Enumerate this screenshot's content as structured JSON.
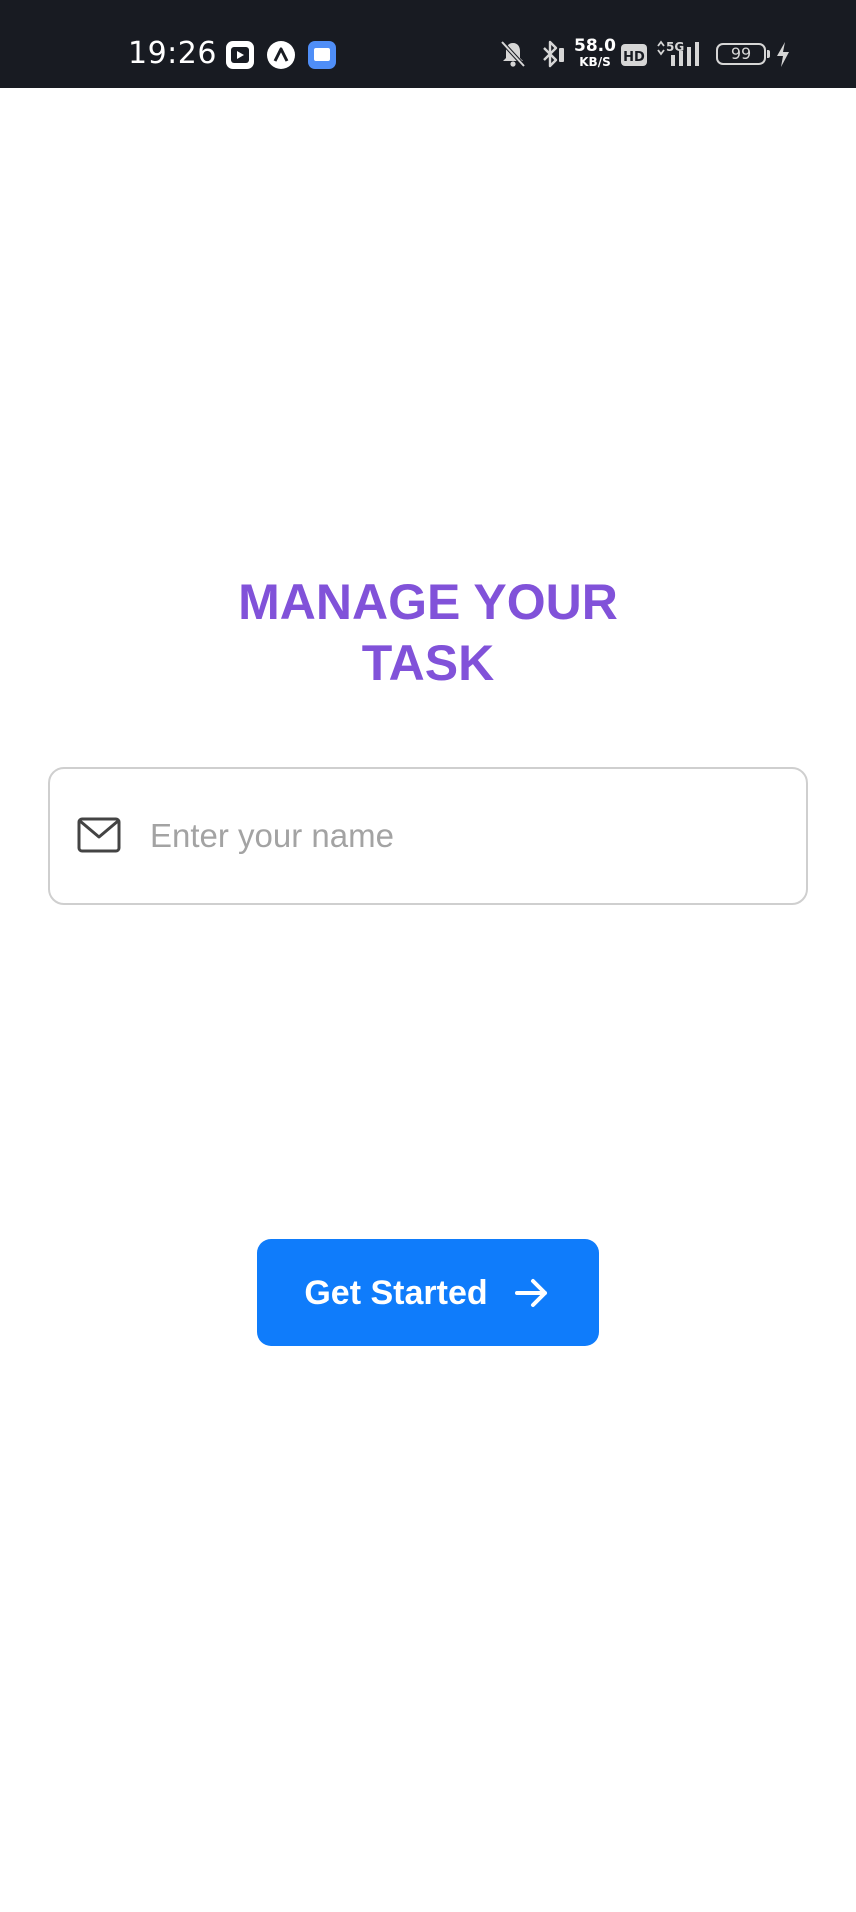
{
  "status_bar": {
    "time": "19:26",
    "apps": [
      "video-app-icon",
      "triangle-app-icon",
      "message-app-icon"
    ],
    "network_speed_value": "58.0",
    "network_speed_unit": "KB/S",
    "hd_label": "HD",
    "network_type": "5G",
    "battery_level": "99",
    "colors": {
      "background": "#181b22",
      "foreground": "#ffffff"
    }
  },
  "main": {
    "title_line1": "MANAGE YOUR",
    "title_line2": "TASK",
    "name_field": {
      "icon": "mail-icon",
      "placeholder": "Enter your name",
      "value": ""
    },
    "get_started": {
      "label": "Get Started",
      "icon": "arrow-right-icon"
    }
  },
  "colors": {
    "title": "#8152d9",
    "button": "#0f7cfb",
    "field_border": "#cfcfcf",
    "placeholder": "#a3a3a3"
  }
}
